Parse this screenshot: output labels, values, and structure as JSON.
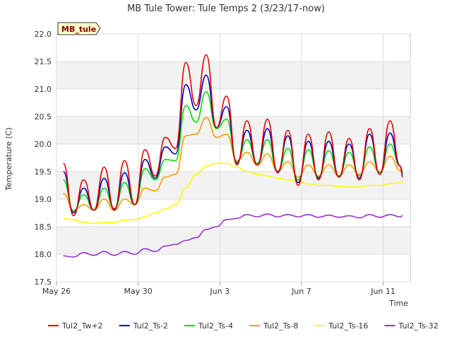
{
  "chart_data": {
    "type": "line",
    "title": "MB Tule Tower: Tule Temps 2 (3/23/17-now)",
    "site_label": "MB_tule",
    "xlabel": "Time",
    "ylabel": "Temperature (C)",
    "ylim": [
      17.5,
      22.0
    ],
    "yticks": [
      "17.5",
      "18.0",
      "18.5",
      "19.0",
      "19.5",
      "20.0",
      "20.5",
      "21.0",
      "21.5",
      "22.0"
    ],
    "xlim": [
      "2017-05-26",
      "2017-06-12"
    ],
    "xticks": [
      {
        "date": "2017-05-26",
        "label": "May 26"
      },
      {
        "date": "2017-05-30",
        "label": "May 30"
      },
      {
        "date": "2017-06-03",
        "label": "Jun 3"
      },
      {
        "date": "2017-06-07",
        "label": "Jun 7"
      },
      {
        "date": "2017-06-11",
        "label": "Jun 11"
      }
    ],
    "grid": true,
    "legend_position": "bottom",
    "x": [
      "2017-05-26",
      "2017-05-26",
      "2017-05-27",
      "2017-05-27",
      "2017-05-28",
      "2017-05-28",
      "2017-05-29",
      "2017-05-29",
      "2017-05-30",
      "2017-05-30",
      "2017-05-31",
      "2017-05-31",
      "2017-06-01",
      "2017-06-01",
      "2017-06-02",
      "2017-06-02",
      "2017-06-03",
      "2017-06-03",
      "2017-06-04",
      "2017-06-04",
      "2017-06-05",
      "2017-06-05",
      "2017-06-06",
      "2017-06-06",
      "2017-06-07",
      "2017-06-07",
      "2017-06-08",
      "2017-06-08",
      "2017-06-09",
      "2017-06-09",
      "2017-06-10",
      "2017-06-10",
      "2017-06-11",
      "2017-06-11",
      "2017-06-11"
    ],
    "x_hours": [
      8,
      20,
      8,
      20,
      8,
      20,
      8,
      20,
      8,
      20,
      8,
      20,
      8,
      20,
      8,
      20,
      8,
      20,
      8,
      20,
      8,
      20,
      8,
      20,
      8,
      20,
      8,
      20,
      8,
      20,
      8,
      20,
      8,
      20,
      23
    ],
    "series": [
      {
        "name": "Tul2_Tw+2",
        "color": "#dd0000",
        "values": [
          19.65,
          18.7,
          19.35,
          18.8,
          19.58,
          18.8,
          19.7,
          18.9,
          19.9,
          19.42,
          20.12,
          19.92,
          21.48,
          20.7,
          21.62,
          20.3,
          20.87,
          19.62,
          20.42,
          19.62,
          20.45,
          19.48,
          20.25,
          19.25,
          20.18,
          19.35,
          20.22,
          19.4,
          20.1,
          19.35,
          20.28,
          19.45,
          20.42,
          19.6,
          19.4
        ]
      },
      {
        "name": "Tul2_Ts-2",
        "color": "#0000bb",
        "values": [
          19.5,
          18.75,
          19.2,
          18.8,
          19.38,
          18.82,
          19.48,
          18.9,
          19.72,
          19.38,
          19.95,
          19.82,
          21.08,
          20.62,
          21.25,
          20.3,
          20.68,
          19.65,
          20.25,
          19.62,
          20.28,
          19.5,
          20.15,
          19.3,
          20.05,
          19.38,
          20.05,
          19.4,
          20.0,
          19.38,
          20.18,
          19.45,
          20.2,
          19.6,
          19.45
        ]
      },
      {
        "name": "Tul2_Ts-4",
        "color": "#00dd00",
        "values": [
          19.35,
          18.78,
          19.08,
          18.8,
          19.2,
          18.82,
          19.3,
          18.9,
          19.55,
          19.35,
          19.72,
          19.7,
          20.7,
          20.4,
          20.95,
          20.28,
          20.45,
          19.68,
          20.08,
          19.65,
          20.08,
          19.5,
          19.92,
          19.35,
          19.9,
          19.4,
          19.88,
          19.42,
          19.85,
          19.42,
          19.95,
          19.48,
          20.0,
          19.6,
          19.5
        ]
      },
      {
        "name": "Tul2_Ts-8",
        "color": "#ff9900",
        "values": [
          19.1,
          18.8,
          18.9,
          18.8,
          19.0,
          18.8,
          19.0,
          18.9,
          19.2,
          19.15,
          19.4,
          19.45,
          20.15,
          20.18,
          20.48,
          20.12,
          20.18,
          19.7,
          19.85,
          19.62,
          19.82,
          19.5,
          19.68,
          19.4,
          19.62,
          19.42,
          19.62,
          19.42,
          19.62,
          19.45,
          19.68,
          19.5,
          19.78,
          19.52,
          19.5
        ]
      },
      {
        "name": "Tul2_Ts-16",
        "color": "#ffff00",
        "values": [
          18.65,
          18.63,
          18.58,
          18.56,
          18.58,
          18.58,
          18.62,
          18.63,
          18.68,
          18.75,
          18.82,
          18.9,
          19.2,
          19.45,
          19.6,
          19.65,
          19.65,
          19.58,
          19.5,
          19.45,
          19.42,
          19.38,
          19.35,
          19.32,
          19.28,
          19.25,
          19.25,
          19.23,
          19.22,
          19.22,
          19.25,
          19.25,
          19.28,
          19.3,
          19.32
        ]
      },
      {
        "name": "Tul2_Ts-32",
        "color": "#9933cc",
        "values": [
          17.97,
          17.95,
          18.03,
          17.98,
          18.05,
          17.98,
          18.05,
          18.0,
          18.1,
          18.05,
          18.15,
          18.18,
          18.25,
          18.3,
          18.45,
          18.5,
          18.63,
          18.65,
          18.72,
          18.68,
          18.73,
          18.68,
          18.72,
          18.68,
          18.72,
          18.67,
          18.71,
          18.67,
          18.7,
          18.66,
          18.72,
          18.67,
          18.72,
          18.68,
          18.7
        ]
      }
    ]
  }
}
